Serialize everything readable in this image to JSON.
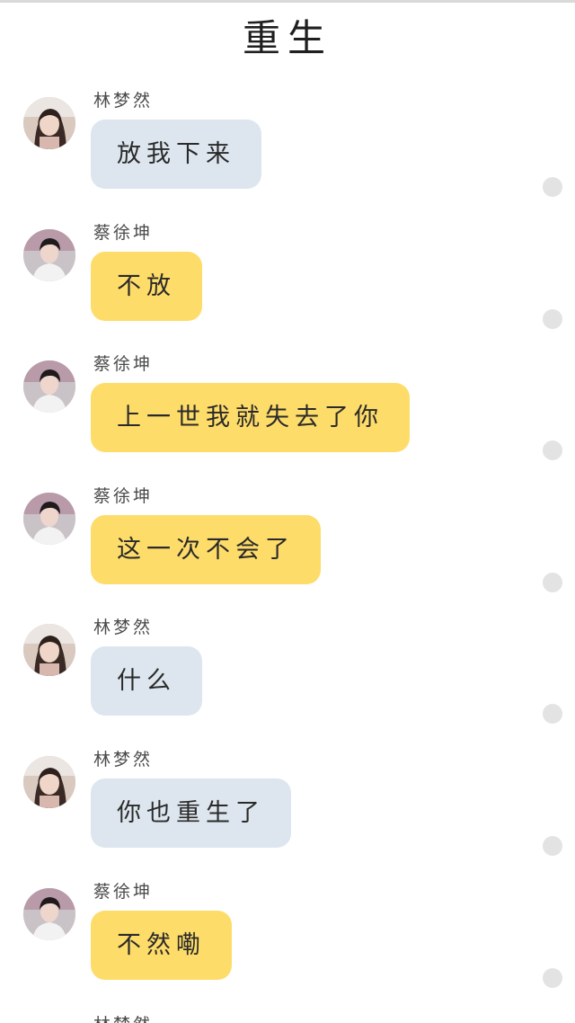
{
  "header": {
    "title": "重生"
  },
  "messages": [
    {
      "sender": "林梦然",
      "text": "放我下来",
      "style": "blue",
      "avatar": "female-avatar"
    },
    {
      "sender": "蔡徐坤",
      "text": "不放",
      "style": "yellow",
      "avatar": "male-avatar"
    },
    {
      "sender": "蔡徐坤",
      "text": "上一世我就失去了你",
      "style": "yellow",
      "avatar": "male-avatar"
    },
    {
      "sender": "蔡徐坤",
      "text": "这一次不会了",
      "style": "yellow",
      "avatar": "male-avatar"
    },
    {
      "sender": "林梦然",
      "text": "什么",
      "style": "blue",
      "avatar": "female-avatar"
    },
    {
      "sender": "林梦然",
      "text": "你也重生了",
      "style": "blue",
      "avatar": "female-avatar"
    },
    {
      "sender": "蔡徐坤",
      "text": "不然嘞",
      "style": "yellow",
      "avatar": "male-avatar"
    }
  ],
  "partial_message": {
    "sender": "林梦然"
  },
  "colors": {
    "female_bubble": "#dde6ee",
    "male_bubble": "#fedc6a",
    "status_dot": "#e3e3e3"
  }
}
